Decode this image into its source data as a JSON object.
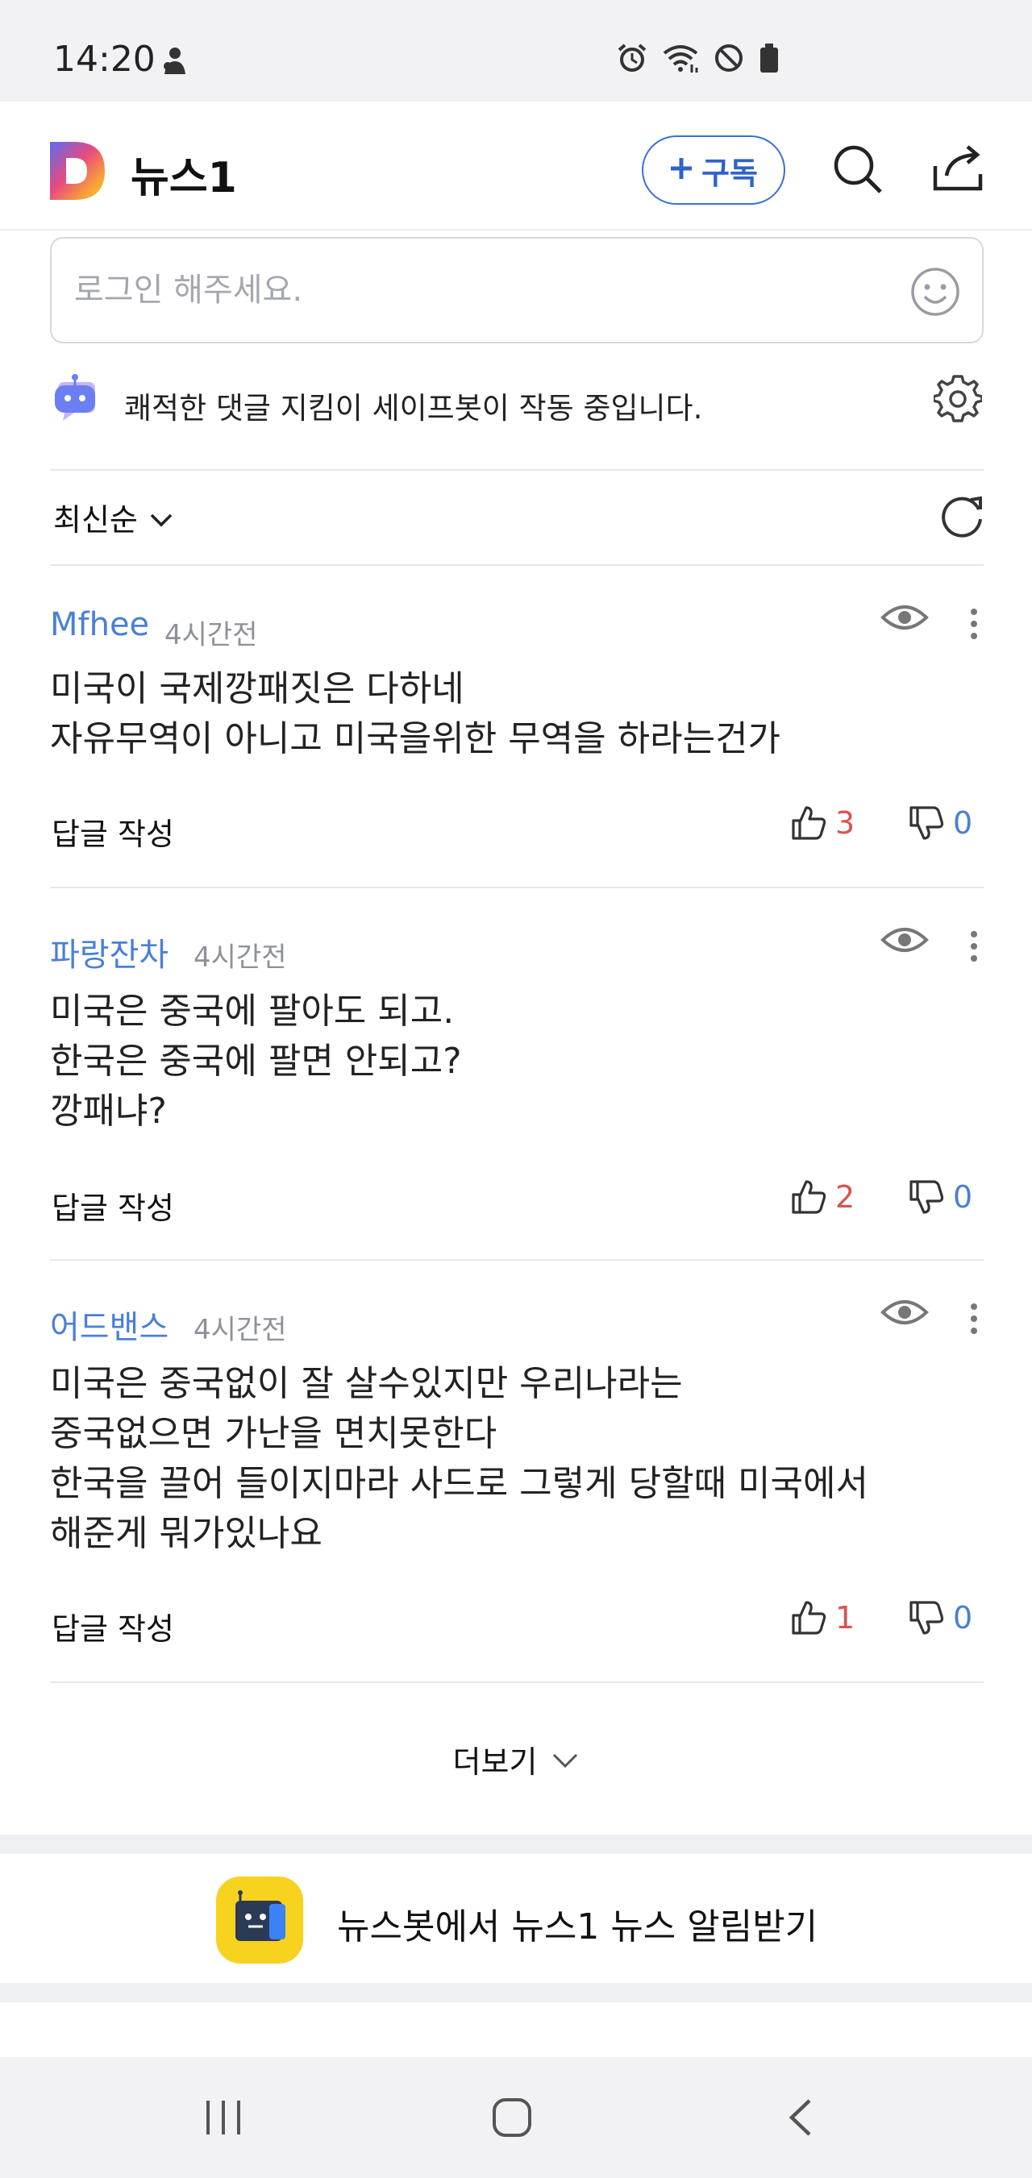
{
  "status_bar": {
    "time": "14:20"
  },
  "header": {
    "app_name": "뉴스1",
    "subscribe_label": "구독",
    "icons": [
      "app-logo",
      "plus-icon",
      "search-icon",
      "share-icon"
    ]
  },
  "comment_input": {
    "placeholder": "로그인 해주세요."
  },
  "safebot": {
    "notice": "쾌적한 댓글 지킴이 세이프봇이 작동 중입니다."
  },
  "sort": {
    "selected": "최신순"
  },
  "comments": [
    {
      "author": "Mfhee",
      "time": "4시간전",
      "lines": [
        "미국이 국제깡패짓은 다하네",
        "자유무역이 아니고 미국을위한 무역을 하라는건가"
      ],
      "reply_label": "답글 작성",
      "likes": "3",
      "dislikes": "0"
    },
    {
      "author": "파랑잔차",
      "time": "4시간전",
      "lines": [
        "미국은 중국에 팔아도 되고.",
        "한국은 중국에 팔면 안되고?",
        "깡패냐?"
      ],
      "reply_label": "답글 작성",
      "likes": "2",
      "dislikes": "0"
    },
    {
      "author": "어드밴스",
      "time": "4시간전",
      "lines": [
        "미국은 중국없이 잘 살수있지만 우리나라는",
        "중국없으면 가난을 면치못한다",
        "한국을 끌어 들이지마라  사드로 그렇게 당할때 미국에서",
        "해준게 뭐가있나요"
      ],
      "reply_label": "답글 작성",
      "likes": "1",
      "dislikes": "0"
    }
  ],
  "more_label": "더보기",
  "newsbot": {
    "label": "뉴스봇에서 뉴스1 뉴스 알림받기"
  },
  "colors": {
    "accent_blue": "#3b6fd4",
    "author_blue": "#4a7fd6",
    "like_red": "#d9534f",
    "newsbot_yellow": "#f7d21e"
  }
}
